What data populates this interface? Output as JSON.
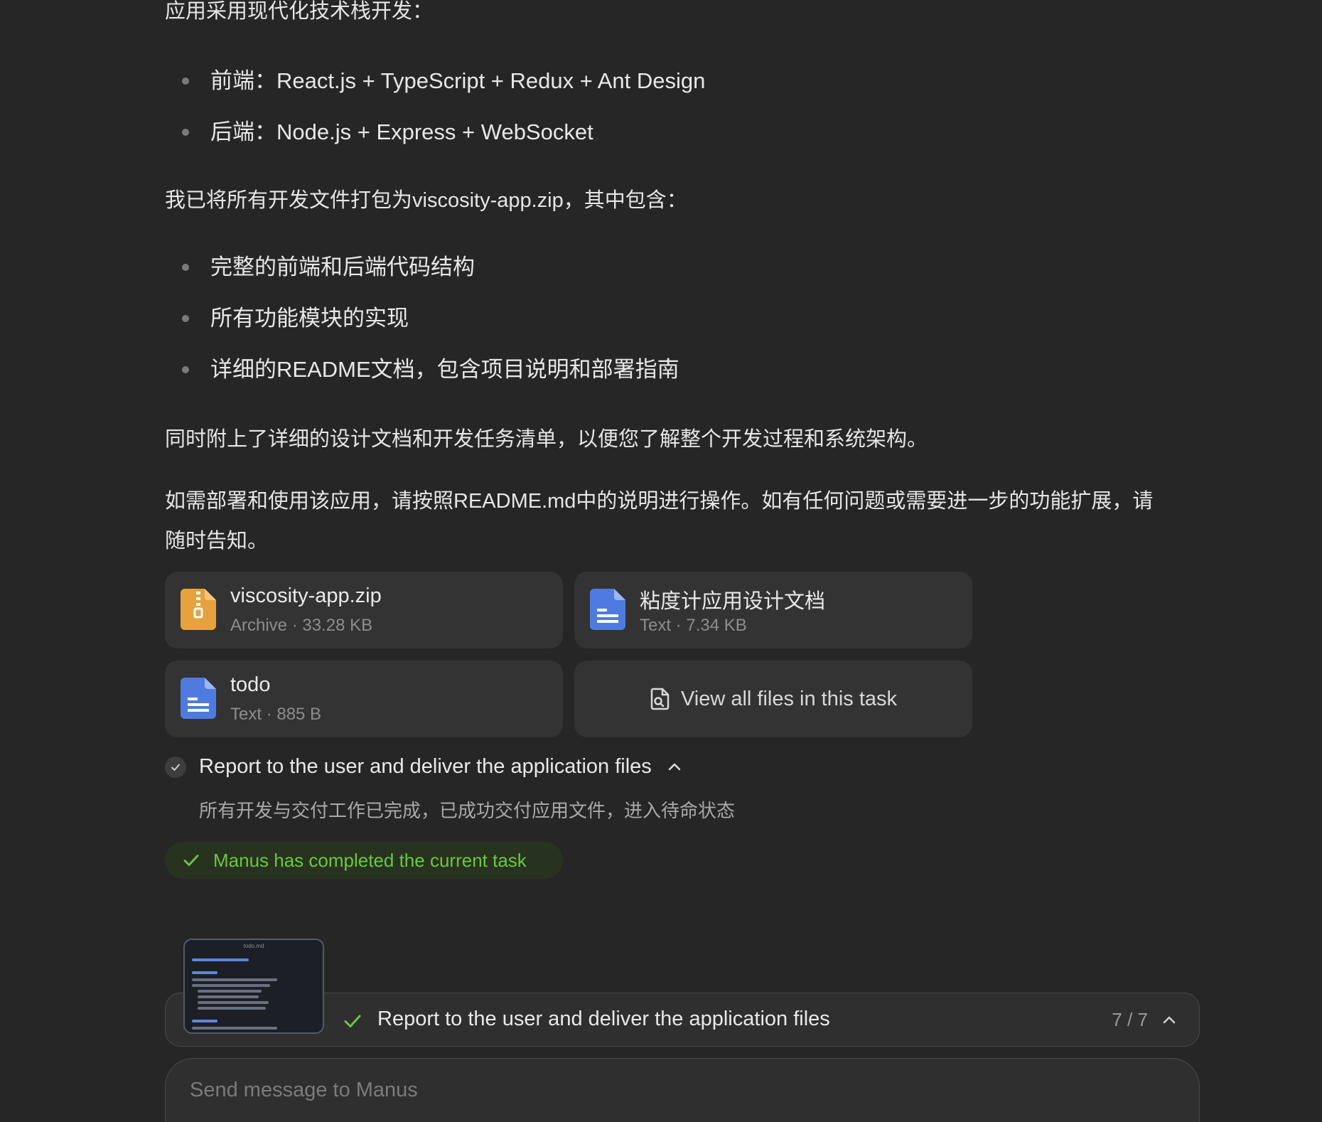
{
  "message": {
    "intro": "应用采用现代化技术栈开发：",
    "stack": [
      "前端：React.js + TypeScript + Redux + Ant Design",
      "后端：Node.js + Express + WebSocket"
    ],
    "package_intro": "我已将所有开发文件打包为viscosity-app.zip，其中包含：",
    "package_items": [
      "完整的前端和后端代码结构",
      "所有功能模块的实现",
      "详细的README文档，包含项目说明和部署指南"
    ],
    "docs_note": "同时附上了详细的设计文档和开发任务清单，以便您了解整个开发过程和系统架构。",
    "closing_line1": "如需部署和使用该应用，请按照README.md中的说明进行操作。如有任何问题或需要进一步的功能扩展，请",
    "closing_line2": "随时告知。"
  },
  "files": [
    {
      "name": "viscosity-app.zip",
      "meta": "Archive · 33.28 KB",
      "icon": "zip-archive-icon",
      "color": "#e6a23c"
    },
    {
      "name": "粘度计应用设计文档",
      "meta": "Text · 7.34 KB",
      "icon": "text-document-icon",
      "color": "#4f7be0"
    },
    {
      "name": "todo",
      "meta": "Text · 885 B",
      "icon": "text-document-icon",
      "color": "#4f7be0"
    }
  ],
  "view_all_label": "View all files in this task",
  "step": {
    "title": "Report to the user and deliver the application files",
    "description": "所有开发与交付工作已完成，已成功交付应用文件，进入待命状态"
  },
  "completion_badge": "Manus has completed the current task",
  "progress": {
    "title": "Report to the user and deliver the application files",
    "count": "7 / 7",
    "thumbnail_title": "todo.md"
  },
  "composer": {
    "placeholder": "Send message to Manus"
  },
  "colors": {
    "background": "#262626",
    "card": "#333333",
    "success": "#6cc644",
    "success_bg": "#27331f"
  }
}
